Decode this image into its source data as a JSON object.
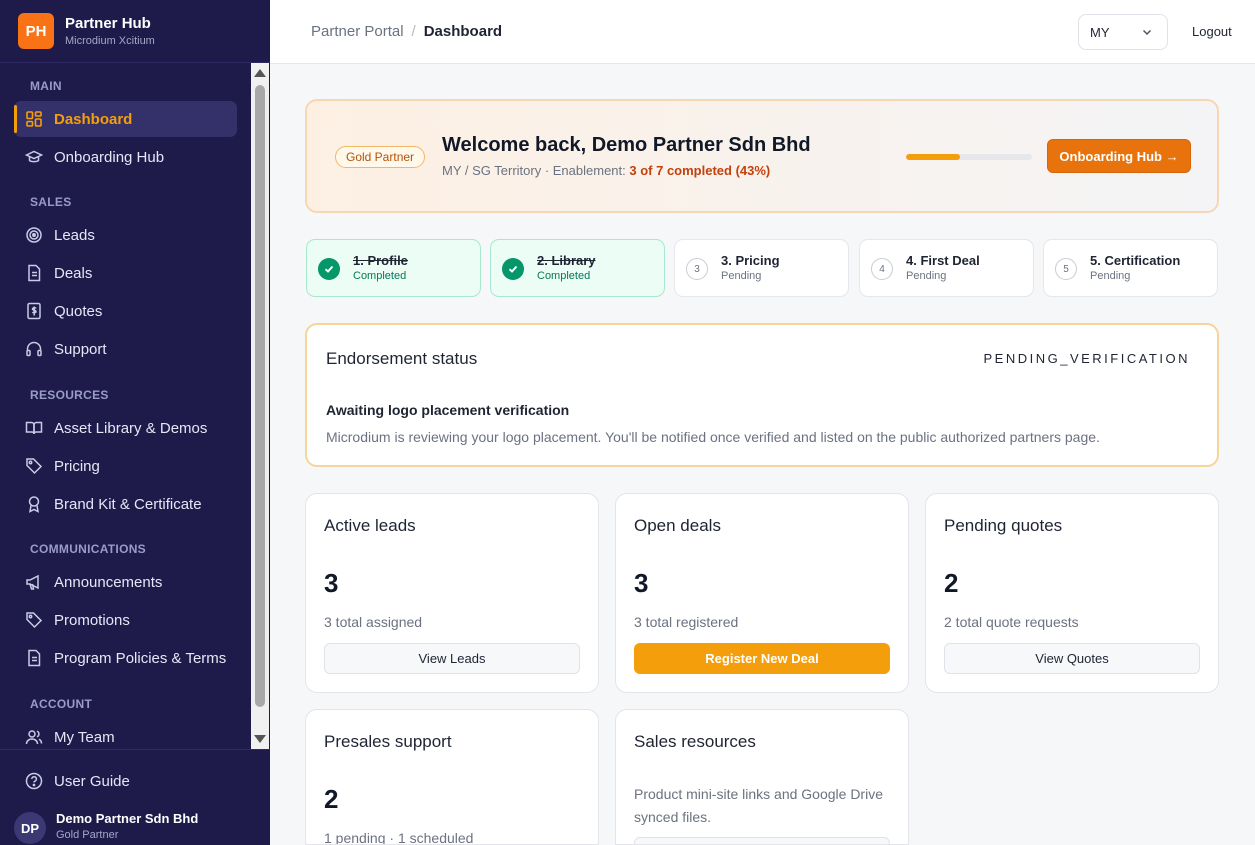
{
  "brand": {
    "logo": "PH",
    "title": "Partner Hub",
    "subtitle": "Microdium Xcitium"
  },
  "sidebar": {
    "sections": [
      "MAIN",
      "SALES",
      "RESOURCES",
      "COMMUNICATIONS",
      "ACCOUNT"
    ],
    "items": [
      {
        "label": "Dashboard",
        "icon": "dashboard-icon",
        "active": true
      },
      {
        "label": "Onboarding Hub",
        "icon": "graduation-cap-icon"
      },
      {
        "label": "Leads",
        "icon": "target-icon"
      },
      {
        "label": "Deals",
        "icon": "document-icon"
      },
      {
        "label": "Quotes",
        "icon": "dollar-receipt-icon"
      },
      {
        "label": "Support",
        "icon": "headset-icon"
      },
      {
        "label": "Asset Library & Demos",
        "icon": "book-open-icon"
      },
      {
        "label": "Pricing",
        "icon": "tag-icon"
      },
      {
        "label": "Brand Kit & Certificate",
        "icon": "award-icon"
      },
      {
        "label": "Announcements",
        "icon": "megaphone-icon"
      },
      {
        "label": "Promotions",
        "icon": "tag-icon"
      },
      {
        "label": "Program Policies & Terms",
        "icon": "document-icon"
      },
      {
        "label": "My Team",
        "icon": "users-icon"
      }
    ],
    "footer": {
      "guide": "User Guide",
      "avatar": "DP",
      "user_name": "Demo Partner Sdn Bhd",
      "user_tier": "Gold Partner"
    }
  },
  "header": {
    "breadcrumb_root": "Partner Portal",
    "breadcrumb_sep": "/",
    "breadcrumb_current": "Dashboard",
    "region": "MY",
    "logout": "Logout"
  },
  "welcome": {
    "badge": "Gold Partner",
    "title": "Welcome back, Demo Partner Sdn Bhd",
    "territory": "MY / SG Territory · Enablement: ",
    "progress_text": "3 of 7 completed (43%)",
    "progress_value": 0.43,
    "hub_button": "Onboarding Hub →"
  },
  "steps": [
    {
      "number": "1",
      "title": "1. Profile",
      "status": "Completed",
      "done": true
    },
    {
      "number": "2",
      "title": "2. Library",
      "status": "Completed",
      "done": true
    },
    {
      "number": "3",
      "title": "3. Pricing",
      "status": "Pending",
      "done": false
    },
    {
      "number": "4",
      "title": "4. First Deal",
      "status": "Pending",
      "done": false
    },
    {
      "number": "5",
      "title": "5. Certification",
      "status": "Pending",
      "done": false
    }
  ],
  "endorsement": {
    "title": "Endorsement status",
    "code": "PENDING_VERIFICATION",
    "heading": "Awaiting logo placement verification",
    "description": "Microdium is reviewing your logo placement. You'll be notified once verified and listed on the public authorized partners page."
  },
  "cards": {
    "leads": {
      "title": "Active leads",
      "count": "3",
      "subtitle": "3 total assigned",
      "button": "View Leads"
    },
    "deals": {
      "title": "Open deals",
      "count": "3",
      "subtitle": "3 total registered",
      "button": "Register New Deal"
    },
    "quotes": {
      "title": "Pending quotes",
      "count": "2",
      "subtitle": "2 total quote requests",
      "button": "View Quotes"
    },
    "presales": {
      "title": "Presales support",
      "count": "2",
      "subtitle": "1 pending · 1 scheduled"
    },
    "resources": {
      "title": "Sales resources",
      "description": "Product mini-site links and Google Drive synced files."
    }
  },
  "colors": {
    "sidebar": "#1e1b4b",
    "accent": "#f59e0b",
    "brand": "#f97316",
    "success": "#059669"
  }
}
